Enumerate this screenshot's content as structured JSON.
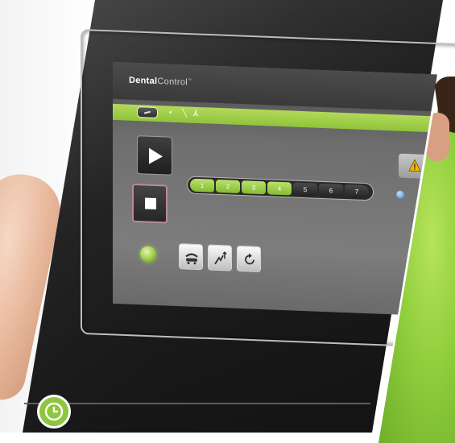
{
  "app": {
    "brand_bold": "Dental",
    "brand_light": "Control",
    "brand_sup": "™"
  },
  "toolbar": {
    "icons": [
      "edit-icon",
      "dot-icon",
      "wrench-icon",
      "tools-icon"
    ]
  },
  "controls": {
    "play_icon": "play-icon",
    "stop_icon": "stop-icon"
  },
  "steps": [
    {
      "label": "1",
      "active": true
    },
    {
      "label": "2",
      "active": true
    },
    {
      "label": "3",
      "active": true
    },
    {
      "label": "4",
      "active": true
    },
    {
      "label": "5",
      "active": false
    },
    {
      "label": "6",
      "active": false
    },
    {
      "label": "7",
      "active": false
    }
  ],
  "status": {
    "warning_icon": "warning-icon",
    "led_color": "#9fd04a",
    "indicator_color": "#3a7bd0"
  },
  "tools": [
    "chair-icon",
    "lamp-adjust-icon",
    "reset-icon"
  ],
  "badge": {
    "icon": "clock-icon",
    "color": "#8ec63f"
  },
  "colors": {
    "accent": "#8fc43b",
    "screen": "#6e6e6e",
    "device": "#1f1f1f"
  }
}
